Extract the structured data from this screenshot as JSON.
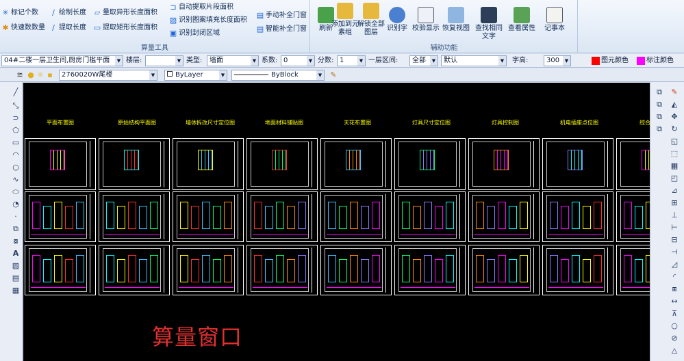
{
  "ribbon": {
    "group1": {
      "label": "算量工具",
      "buttons": [
        "标记个数",
        "快速数数量",
        "绘制长度",
        "提取长度",
        "量取异形长度面积",
        "提取矩形长度面积",
        "自动提取片段面积",
        "识别图案填充长度面积",
        "识别封闭区域",
        "手动补全门窗",
        "智能补全门窗"
      ]
    },
    "group2": {
      "label": "辅助功能",
      "buttons": [
        "刷新",
        "添加到元素组",
        "解锁全部图层",
        "识别字",
        "校验显示",
        "恢复视图",
        "查找相同文字",
        "查看属性",
        "记事本"
      ]
    }
  },
  "props": {
    "file": "04#二楼一层卫生间,厨房门槛平面",
    "floor_label": "楼层:",
    "floor_value": "",
    "category_label": "类型:",
    "category_value": "墙面",
    "count_label": "系数:",
    "count_value": "0",
    "layer_label": "分数:",
    "layer_value": "1",
    "filter_label": "一层区间:",
    "filter_value": "全部",
    "default_value": "默认",
    "font_label": "字高:",
    "font_value": "300",
    "fill_label": "图元颜色",
    "mark_label": "标注颜色",
    "colors": {
      "fill": "#ff0000",
      "mark": "#ff00ff",
      "accent": "#e0302e"
    }
  },
  "layerbar": {
    "layer": "2760020W尾楼",
    "color": "ByLayer",
    "linetype": "ByBlock"
  },
  "canvas": {
    "titles": [
      "平面布置图",
      "原始结构平面图",
      "墙体拆改尺寸定位图",
      "地面材料铺贴图",
      "天花布置图",
      "灯具尺寸定位图",
      "灯具控制图",
      "机电插座点位图",
      "综合天花"
    ]
  },
  "overlay": {
    "text": "算量窗口"
  }
}
